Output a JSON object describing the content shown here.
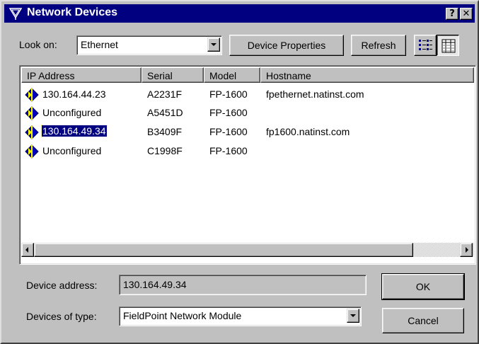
{
  "window": {
    "title": "Network Devices",
    "help_label": "?",
    "close_label": "✕"
  },
  "toolbar": {
    "look_on_label": "Look on:",
    "look_on_value": "Ethernet",
    "device_properties_label": "Device Properties",
    "refresh_label": "Refresh",
    "list_view_icon": "list-view-icon",
    "details_view_icon": "details-view-icon"
  },
  "device_list": {
    "columns": [
      "IP Address",
      "Serial",
      "Model",
      "Hostname"
    ],
    "selected_row": 2,
    "rows": [
      {
        "ip": "130.164.44.23",
        "serial": "A2231F",
        "model": "FP-1600",
        "hostname": "fpethernet.natinst.com"
      },
      {
        "ip": "Unconfigured",
        "serial": "A5451D",
        "model": "FP-1600",
        "hostname": ""
      },
      {
        "ip": "130.164.49.34",
        "serial": "B3409F",
        "model": "FP-1600",
        "hostname": "fp1600.natinst.com"
      },
      {
        "ip": "Unconfigured",
        "serial": "C1998F",
        "model": "FP-1600",
        "hostname": ""
      }
    ]
  },
  "footer": {
    "device_address_label": "Device address:",
    "device_address_value": "130.164.49.34",
    "devices_of_type_label": "Devices of type:",
    "devices_of_type_value": "FieldPoint Network Module",
    "ok_label": "OK",
    "cancel_label": "Cancel"
  },
  "colors": {
    "titlebar": "#000080",
    "face": "#c0c0c0",
    "selection": "#000080"
  }
}
